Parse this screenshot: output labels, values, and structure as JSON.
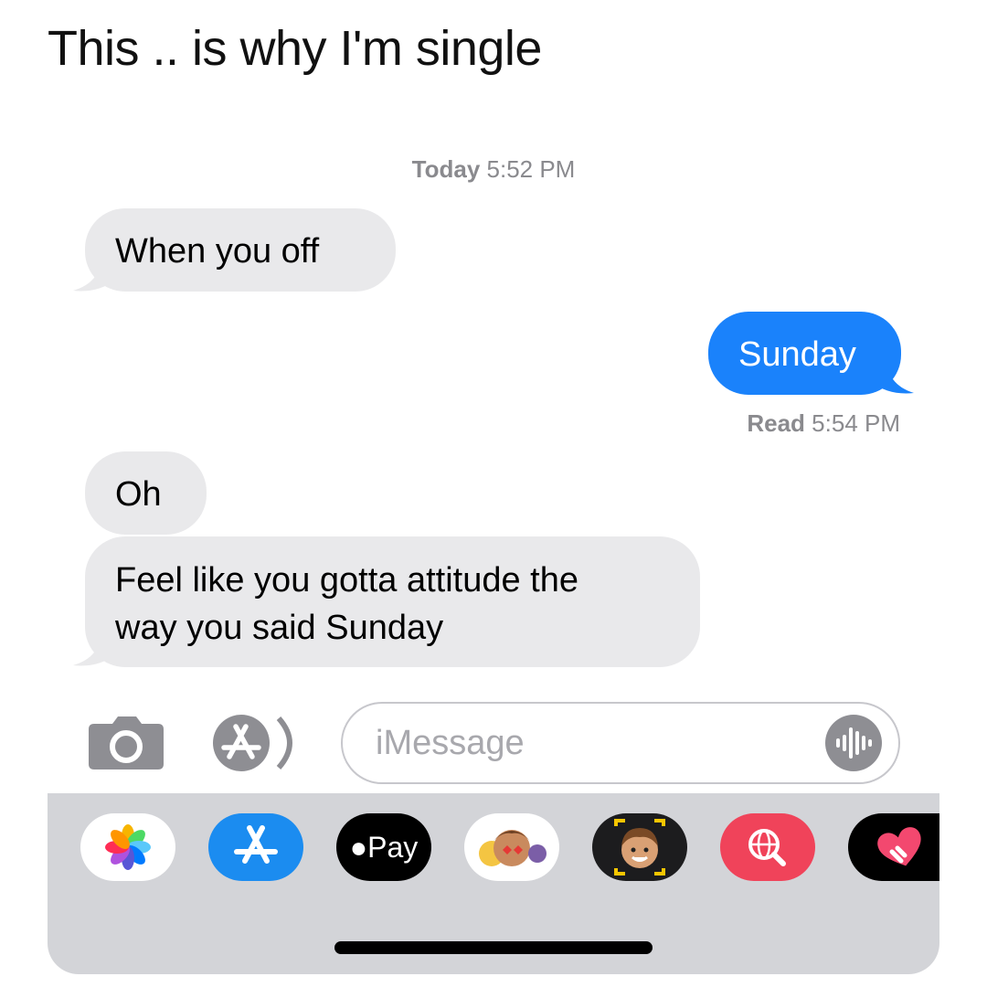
{
  "caption": "This .. is why I'm single",
  "timestamp": {
    "day": "Today",
    "time": "5:52 PM"
  },
  "messages": [
    {
      "direction": "received",
      "text": "When you off"
    },
    {
      "direction": "sent",
      "text": "Sunday"
    },
    {
      "direction": "received",
      "text": "Oh"
    },
    {
      "direction": "received",
      "lines": [
        "Feel like you gotta attitude the",
        "way you said Sunday"
      ]
    }
  ],
  "read_receipt": {
    "status": "Read",
    "time": "5:54 PM"
  },
  "input": {
    "placeholder": "iMessage"
  },
  "app_drawer": {
    "apple_pay_label": "Pay",
    "items": [
      "photos-app",
      "app-store",
      "apple-pay",
      "animoji-stickers",
      "memoji",
      "web-search",
      "digital-touch"
    ]
  },
  "colors": {
    "sent_bubble": "#1a82fb",
    "received_bubble": "#e9e9eb",
    "meta_text": "#8a8a8e",
    "drawer_bg": "#d3d4d8",
    "search_app": "#f0435a",
    "app_store": "#1b8cf0"
  }
}
